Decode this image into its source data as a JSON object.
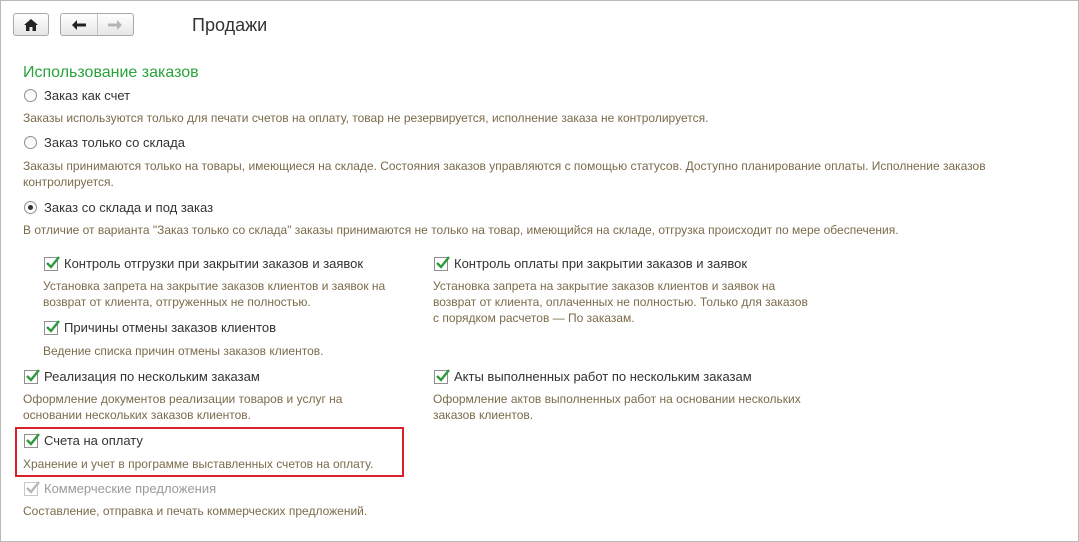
{
  "header": {
    "title": "Продажи",
    "home_icon": "home-icon",
    "back_icon": "arrow-left-icon",
    "forward_icon": "arrow-right-icon"
  },
  "section": {
    "title": "Использование заказов"
  },
  "radios": [
    {
      "label": "Заказ как счет",
      "checked": false,
      "description": "Заказы используются  только для печати счетов на оплату, товар не резервируется, исполнение заказа не контролируется."
    },
    {
      "label": "Заказ только со склада",
      "checked": false,
      "description": "Заказы принимаются только на товары, имеющиеся на складе. Состояния заказов управляются с помощью статусов. Доступно планирование оплаты. Исполнение заказов контролируется."
    },
    {
      "label": "Заказ со склада и под заказ",
      "checked": true,
      "description": "В отличие от варианта \"Заказ только со склада\" заказы принимаются не только на товар, имеющийся на складе, отгрузка происходит по мере обеспечения."
    }
  ],
  "checks": {
    "shipment_control": {
      "label": "Контроль отгрузки при закрытии заказов и заявок",
      "checked": true,
      "description": "Установка запрета на закрытие заказов клиентов и заявок на возврат от клиента, отгруженных не полностью."
    },
    "payment_control": {
      "label": "Контроль оплаты при закрытии заказов и заявок",
      "checked": true,
      "description": "Установка запрета на закрытие заказов клиентов и заявок на возврат от клиента, оплаченных не полностью. Только для заказов с порядком расчетов — По заказам."
    },
    "cancel_reasons": {
      "label": "Причины отмены заказов клиентов",
      "checked": true,
      "description": "Ведение списка причин отмены заказов клиентов."
    },
    "sales_multi": {
      "label": "Реализация по нескольким заказам",
      "checked": true,
      "description": "Оформление документов реализации товаров и услуг на основании нескольких заказов клиентов."
    },
    "acts_multi": {
      "label": "Акты выполненных работ по нескольким заказам",
      "checked": true,
      "description": "Оформление актов выполненных работ на основании нескольких заказов клиентов."
    },
    "invoices": {
      "label": "Счета на оплату",
      "checked": true,
      "description": "Хранение и учет в программе выставленных счетов на оплату."
    },
    "offers": {
      "label": "Коммерческие предложения",
      "checked": true,
      "disabled": true,
      "description": "Составление, отправка и печать коммерческих предложений."
    }
  },
  "colors": {
    "section_title": "#29a33c",
    "description": "#7b6b4b",
    "check_mark": "#2e9a3c",
    "highlight": "#d8212a"
  }
}
